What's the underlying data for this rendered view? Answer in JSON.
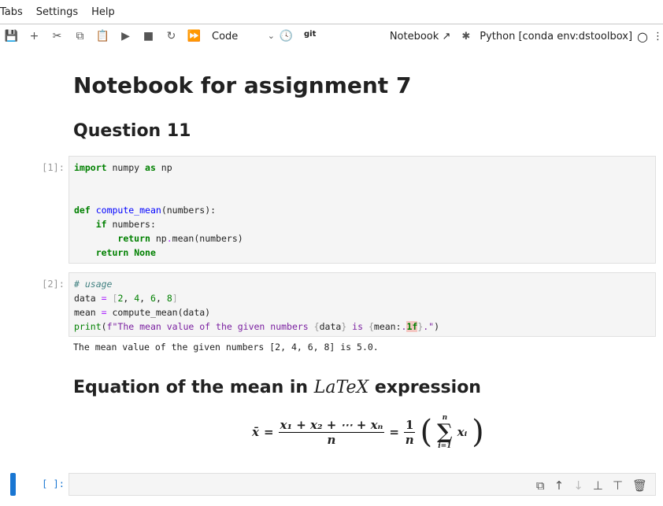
{
  "menu": [
    "Tabs",
    "Settings",
    "Help"
  ],
  "toolbar": {
    "cell_type": "Code",
    "git": "git",
    "notebook": "Notebook",
    "kernel": "Python [conda env:dstoolbox]"
  },
  "title": "Notebook for assignment 7",
  "h_question": "Question 11",
  "h_equation_pre": "Equation of the mean in",
  "h_equation_latex": "LaTeX",
  "h_equation_post": "expression",
  "cells": [
    {
      "prompt": "[1]:",
      "lines": [
        [
          {
            "t": "import",
            "c": "kw"
          },
          {
            "t": " numpy "
          },
          {
            "t": "as",
            "c": "kw"
          },
          {
            "t": " np"
          }
        ],
        [],
        [],
        [
          {
            "t": "def",
            "c": "kw"
          },
          {
            "t": " "
          },
          {
            "t": "compute_mean",
            "c": "fn"
          },
          {
            "t": "(numbers):"
          }
        ],
        [
          {
            "t": "    "
          },
          {
            "t": "if",
            "c": "kw"
          },
          {
            "t": " numbers:"
          }
        ],
        [
          {
            "t": "        "
          },
          {
            "t": "return",
            "c": "kw"
          },
          {
            "t": " np"
          },
          {
            "t": ".",
            "c": "op"
          },
          {
            "t": "mean(numbers)"
          }
        ],
        [
          {
            "t": "    "
          },
          {
            "t": "return",
            "c": "kw"
          },
          {
            "t": " "
          },
          {
            "t": "None",
            "c": "kw"
          }
        ]
      ]
    },
    {
      "prompt": "[2]:",
      "lines": [
        [
          {
            "t": "# usage",
            "c": "cm"
          }
        ],
        [
          {
            "t": "data "
          },
          {
            "t": "=",
            "c": "op"
          },
          {
            "t": " "
          },
          {
            "t": "[",
            "c": "br"
          },
          {
            "t": "2",
            "c": "num"
          },
          {
            "t": ", "
          },
          {
            "t": "4",
            "c": "num"
          },
          {
            "t": ", "
          },
          {
            "t": "6",
            "c": "num"
          },
          {
            "t": ", "
          },
          {
            "t": "8",
            "c": "num"
          },
          {
            "t": "]",
            "c": "br"
          }
        ],
        [
          {
            "t": "mean "
          },
          {
            "t": "=",
            "c": "op"
          },
          {
            "t": " compute_mean(data)"
          }
        ],
        [
          {
            "t": "print",
            "c": "bi"
          },
          {
            "t": "("
          },
          {
            "t": "f\"The mean value of the given numbers ",
            "c": "fs"
          },
          {
            "t": "{",
            "c": "ob"
          },
          {
            "t": "data"
          },
          {
            "t": "}",
            "c": "ob"
          },
          {
            "t": " is ",
            "c": "fs"
          },
          {
            "t": "{",
            "c": "ob"
          },
          {
            "t": "mean:"
          },
          {
            "t": ".",
            "c": "fs"
          },
          {
            "t": "1f",
            "c": "hl"
          },
          {
            "t": "}",
            "c": "ob"
          },
          {
            "t": ".\"",
            "c": "fs"
          },
          {
            "t": ")"
          }
        ]
      ]
    }
  ],
  "output": "The mean value of the given numbers [2, 4, 6, 8] is 5.0.",
  "equation": {
    "lhs": "x̄",
    "eq": "=",
    "numer": "x₁ + x₂ + ⋯ + xₙ",
    "denom": "n",
    "one": "1",
    "n": "n",
    "sum_top": "n",
    "sum_bottom": "i=1",
    "sum_term": "xᵢ"
  },
  "empty_prompt": "[ ]:"
}
